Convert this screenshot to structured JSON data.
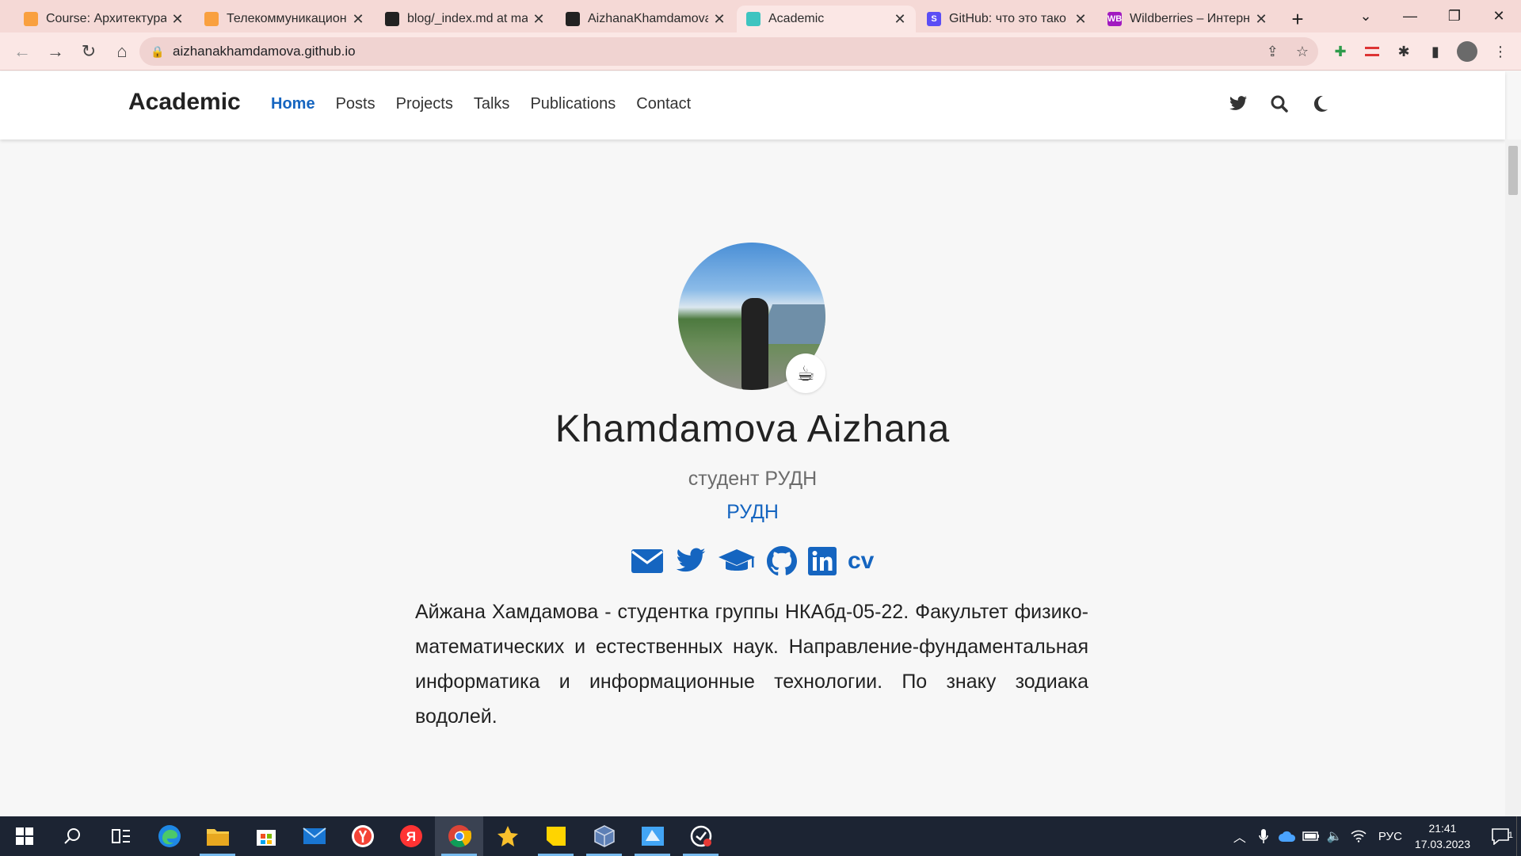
{
  "browser": {
    "tabs": [
      {
        "title": "Course: Архитектура",
        "favicon_color": "#f9a03f",
        "active": false
      },
      {
        "title": "Телекоммуникацион",
        "favicon_color": "#f9a03f",
        "active": false
      },
      {
        "title": "blog/_index.md at ma",
        "favicon_color": "#222222",
        "active": false
      },
      {
        "title": "AizhanaKhamdamova",
        "favicon_color": "#222222",
        "active": false
      },
      {
        "title": "Academic",
        "favicon_color": "#3ec4c0",
        "active": true
      },
      {
        "title": "GitHub: что это тако",
        "favicon_color": "#5b4df5",
        "favicon_letter": "S",
        "active": false
      },
      {
        "title": "Wildberries – Интерн",
        "favicon_color": "#a11ac0",
        "favicon_letter": "WB",
        "active": false
      }
    ],
    "new_tab_label": "+",
    "url": "aizhanakhamdamova.github.io"
  },
  "site": {
    "brand": "Academic",
    "menu": [
      {
        "label": "Home",
        "active": true
      },
      {
        "label": "Posts",
        "active": false
      },
      {
        "label": "Projects",
        "active": false
      },
      {
        "label": "Talks",
        "active": false
      },
      {
        "label": "Publications",
        "active": false
      },
      {
        "label": "Contact",
        "active": false
      }
    ],
    "header_icons": [
      "twitter-icon",
      "search-icon",
      "moon-icon"
    ]
  },
  "profile": {
    "name": "Khamdamova Aizhana",
    "role": "студент РУДН",
    "organization": "РУДН",
    "status_emoji": "☕",
    "socials": [
      "envelope-icon",
      "twitter-icon",
      "graduation-cap-icon",
      "github-icon",
      "linkedin-icon",
      "cv-icon"
    ],
    "cv_label": "cv",
    "bio": "Айжана Хамдамова - студентка группы НКАбд-05-22. Факультет физико-математических и естественных наук. Направление-фундаментальная информатика и информационные технологии. По знаку зодиака водолей."
  },
  "taskbar": {
    "apps": [
      "start-icon",
      "search-icon",
      "task-view-icon",
      "edge-icon",
      "file-explorer-icon",
      "store-icon",
      "mail-icon",
      "yandex-browser-icon",
      "yandex-icon",
      "chrome-icon",
      "star-app-icon",
      "sticky-notes-icon",
      "virtualbox-icon",
      "vpn-app-icon",
      "screen-recorder-icon"
    ],
    "language": "РУС",
    "time": "21:41",
    "date": "17.03.2023",
    "notification_count": "1"
  },
  "colors": {
    "accent": "#1565c0",
    "tabstrip": "#f5d9d6",
    "toolbar": "#fbe7e5",
    "taskbar": "#1c2433"
  }
}
